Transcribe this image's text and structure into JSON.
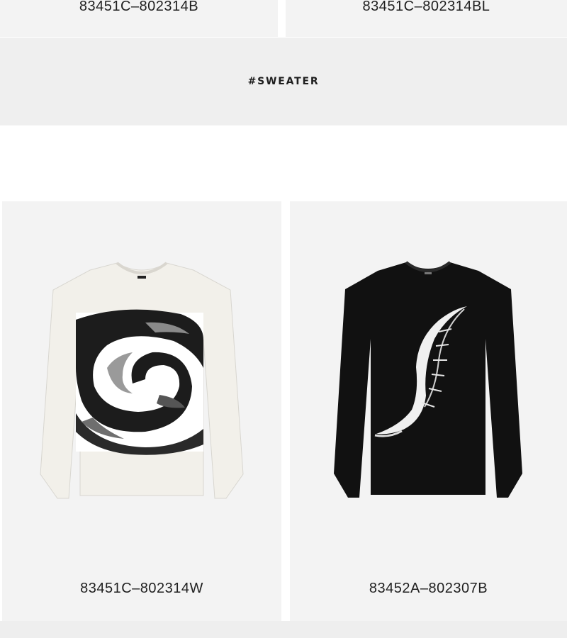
{
  "top_row": {
    "left_sku": "83451C–802314B",
    "right_sku": "83451C–802314BL"
  },
  "banner": {
    "tag": "#SWEATER"
  },
  "products": [
    {
      "sku": "83451C–802314W",
      "image": "white-swirl-sweater",
      "body_color": "#f1efe9",
      "pattern_color": "#1a1a1a"
    },
    {
      "sku": "83452A–802307B",
      "image": "black-feather-sweater",
      "body_color": "#0f0f0f",
      "pattern_color": "#efefef"
    }
  ]
}
